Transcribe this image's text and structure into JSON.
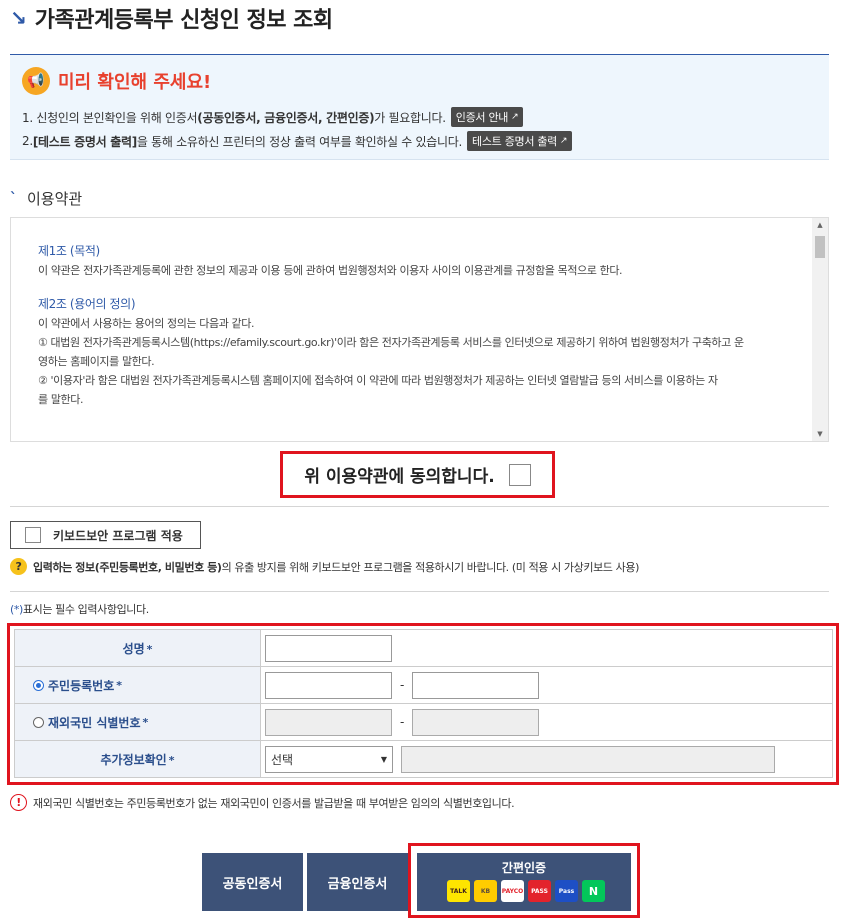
{
  "page": {
    "title": "가족관계등록부 신청인 정보 조회"
  },
  "notice": {
    "heading": "미리 확인해 주세요!",
    "line1_pre": "1. 신청인의 본인확인을 위해 인증서",
    "line1_bold": "(공동인증서, 금융인증서, 간편인증)",
    "line1_post": "가 필요합니다.",
    "line1_button": "인증서 안내",
    "line2_pre": "2.",
    "line2_bold": "[테스트 증명서 출력]",
    "line2_post": "을 통해 소유하신 프린터의 정상 출력 여부를 확인하실 수 있습니다.",
    "line2_button": "테스트 증명서 출력"
  },
  "terms": {
    "section_title": "이용약관",
    "art1_title": "제1조 (목적)",
    "art1_text": "이 약관은 전자가족관계등록에 관한 정보의 제공과 이용 등에 관하여 법원행정처와 이용자 사이의 이용관계를 규정함을 목적으로 한다.",
    "art2_title": "제2조 (용어의 정의)",
    "art2_text": "이 약관에서 사용하는 용어의 정의는 다음과 같다.",
    "art2_item1a": "① 대법원 전자가족관계등록시스템(https://efamily.scourt.go.kr)'이라 함은 전자가족관계등록 서비스를 인터넷으로 제공하기 위하여 법원행정처가 구축하고 운",
    "art2_item1b": "영하는 홈페이지를 말한다.",
    "art2_item2a": "② '이용자'라 함은 대법원 전자가족관계등록시스템 홈페이지에 접속하여 이 약관에 따라 법원행정처가 제공하는 인터넷 열람발급 등의 서비스를 이용하는 자",
    "art2_item2b": "를 말한다."
  },
  "agree": {
    "label": "위 이용약관에 동의합니다."
  },
  "keyboard": {
    "button": "키보드보안 프로그램 적용",
    "help_bold": "입력하는 정보(주민등록번호, 비밀번호 등)",
    "help_rest": "의 유출 방지를 위해 키보드보안 프로그램을 적용하시기 바랍니다. (미 적용 시 가상키보드 사용)"
  },
  "required_note": {
    "mark": "(*)",
    "text": " 표시는 필수 입력사항입니다."
  },
  "form": {
    "name_label": "성명",
    "rrn_label": "주민등록번호",
    "foreign_label": "재외국민 식별번호",
    "extra_label": "추가정보확인",
    "star": "*",
    "dash": "-",
    "select_value": "선택"
  },
  "foreign_note": "재외국민 식별번호는 주민등록번호가 없는 재외국민이 인증서를 발급받을 때 부여받은 임의의 식별번호입니다.",
  "auth": {
    "joint": "공동인증서",
    "financial": "금융인증서",
    "simple": "간편인증",
    "logos": [
      {
        "name": "kakao-talk-logo",
        "text": "TALK",
        "bg": "#fee500",
        "fg": "#3c1e1e"
      },
      {
        "name": "kb-logo",
        "text": "KB",
        "bg": "#ffcc00",
        "fg": "#5b4b3a"
      },
      {
        "name": "payco-logo",
        "text": "PAYCO",
        "bg": "#ffffff",
        "fg": "#e3232c"
      },
      {
        "name": "pass-logo",
        "text": "PASS",
        "bg": "#e3232c",
        "fg": "#ffffff"
      },
      {
        "name": "samsung-pass-logo",
        "text": "Pass",
        "bg": "#1e4fc5",
        "fg": "#ffffff"
      },
      {
        "name": "naver-logo",
        "text": "N",
        "bg": "#03c75a",
        "fg": "#ffffff"
      }
    ]
  },
  "colors": {
    "accent": "#2f5aa8",
    "highlight": "#e0141e",
    "button": "#3d5278"
  }
}
